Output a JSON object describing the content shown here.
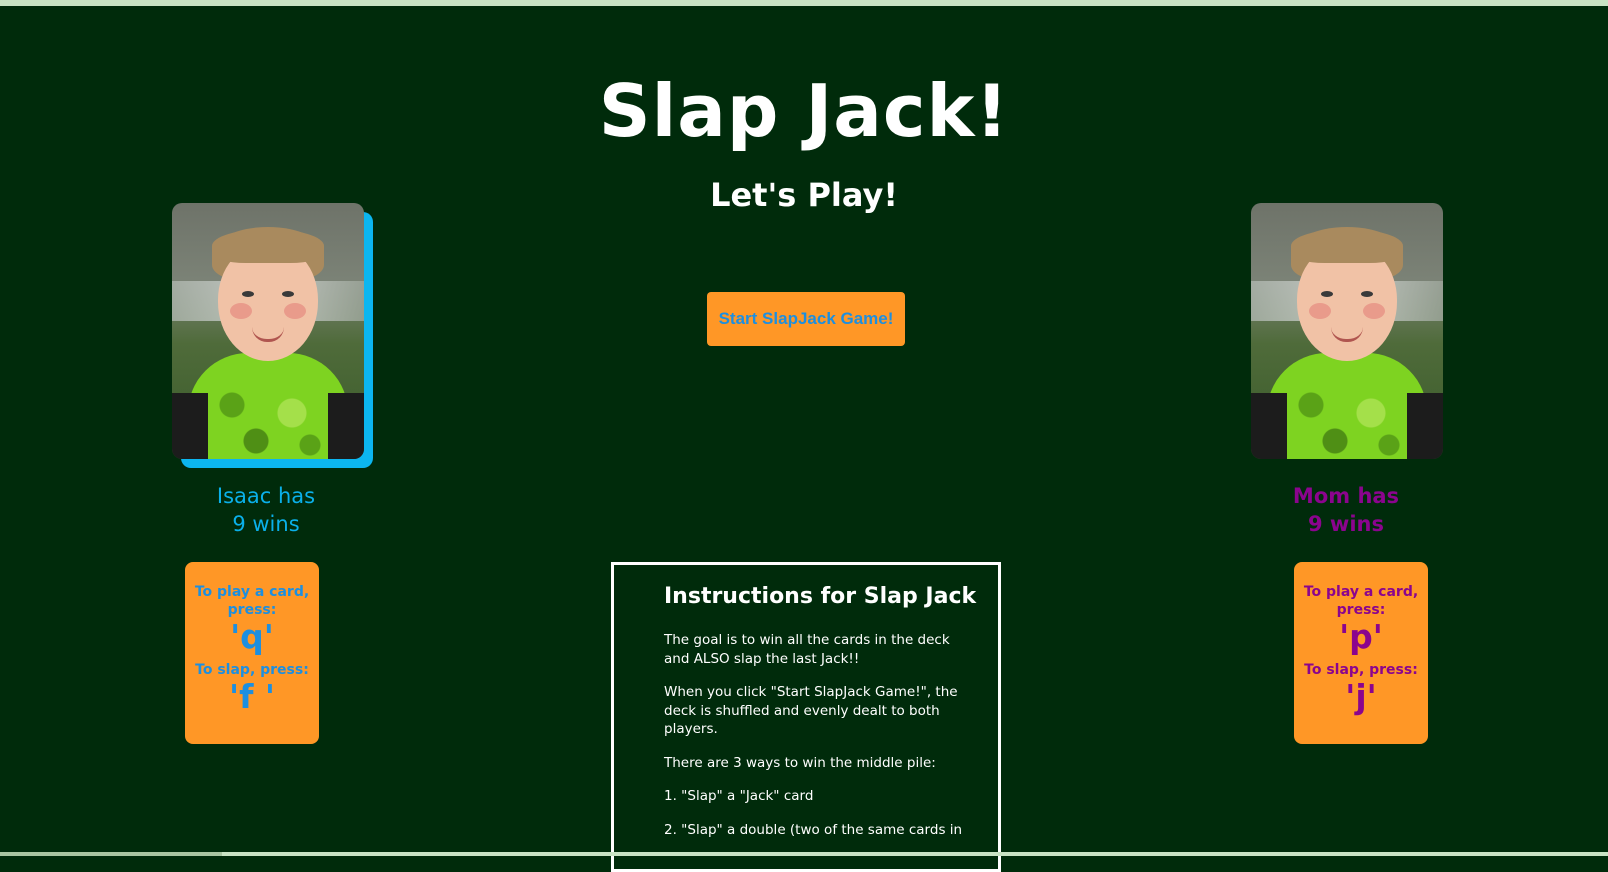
{
  "page": {
    "title": "Slap Jack!",
    "subtitle": "Let's Play!"
  },
  "players": {
    "left": {
      "name": "Isaac",
      "wins_line1": "Isaac has",
      "wins_line2": "9 wins",
      "color": "#0ab0ea",
      "controls": {
        "play_label": "To play a card, press:",
        "play_key": "'q'",
        "slap_label": "To slap, press:",
        "slap_key": "'f '"
      }
    },
    "right": {
      "name": "Mom",
      "wins_line1": "Mom has",
      "wins_line2": "9 wins",
      "color": "#8b048e",
      "controls": {
        "play_label": "To play a card, press:",
        "play_key": "'p'",
        "slap_label": "To slap, press:",
        "slap_key": "'j'"
      }
    }
  },
  "start_button": {
    "label": "Start SlapJack Game!"
  },
  "instructions": {
    "title": "Instructions for Slap Jack",
    "paragraphs": [
      "The goal is to win all the cards in the deck and ALSO slap the last Jack!!",
      "When you click \"Start SlapJack Game!\", the deck is shuffled and evenly dealt to both players.",
      "There are 3 ways to win the middle pile:",
      "1. \"Slap\" a \"Jack\" card",
      "2. \"Slap\" a double (two of the same cards in"
    ]
  },
  "colors": {
    "background": "#002b0b",
    "accent_orange": "#ff9726",
    "player_left": "#0ab0ea",
    "player_right": "#8b048e"
  }
}
